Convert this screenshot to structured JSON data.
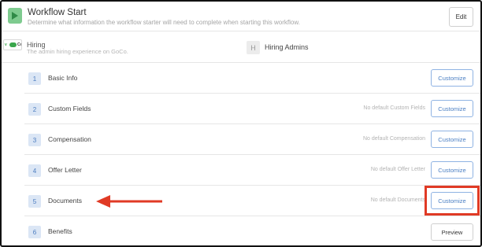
{
  "header": {
    "title": "Workflow Start",
    "subtitle": "Determine what information the workflow starter will need to complete when starting this workflow.",
    "edit_label": "Edit"
  },
  "hiring": {
    "logo_text": "GoCo",
    "title": "Hiring",
    "subtitle": "The admin hiring experience on GoCo.",
    "avatar_letter": "H",
    "admins_label": "Hiring Admins"
  },
  "steps": [
    {
      "number": "1",
      "label": "Basic Info",
      "message": "",
      "button": "Customize"
    },
    {
      "number": "2",
      "label": "Custom Fields",
      "message": "No default Custom Fields",
      "button": "Customize"
    },
    {
      "number": "3",
      "label": "Compensation",
      "message": "No default Compensation",
      "button": "Customize"
    },
    {
      "number": "4",
      "label": "Offer Letter",
      "message": "No default Offer Letter",
      "button": "Customize"
    },
    {
      "number": "5",
      "label": "Documents",
      "message": "No default Documents",
      "button": "Customize"
    },
    {
      "number": "6",
      "label": "Benefits",
      "message": "",
      "button": "Preview"
    }
  ],
  "colors": {
    "accent_blue": "#4b7fc3",
    "play_green": "#7ecb8f",
    "annotation_red": "#e03a25"
  }
}
